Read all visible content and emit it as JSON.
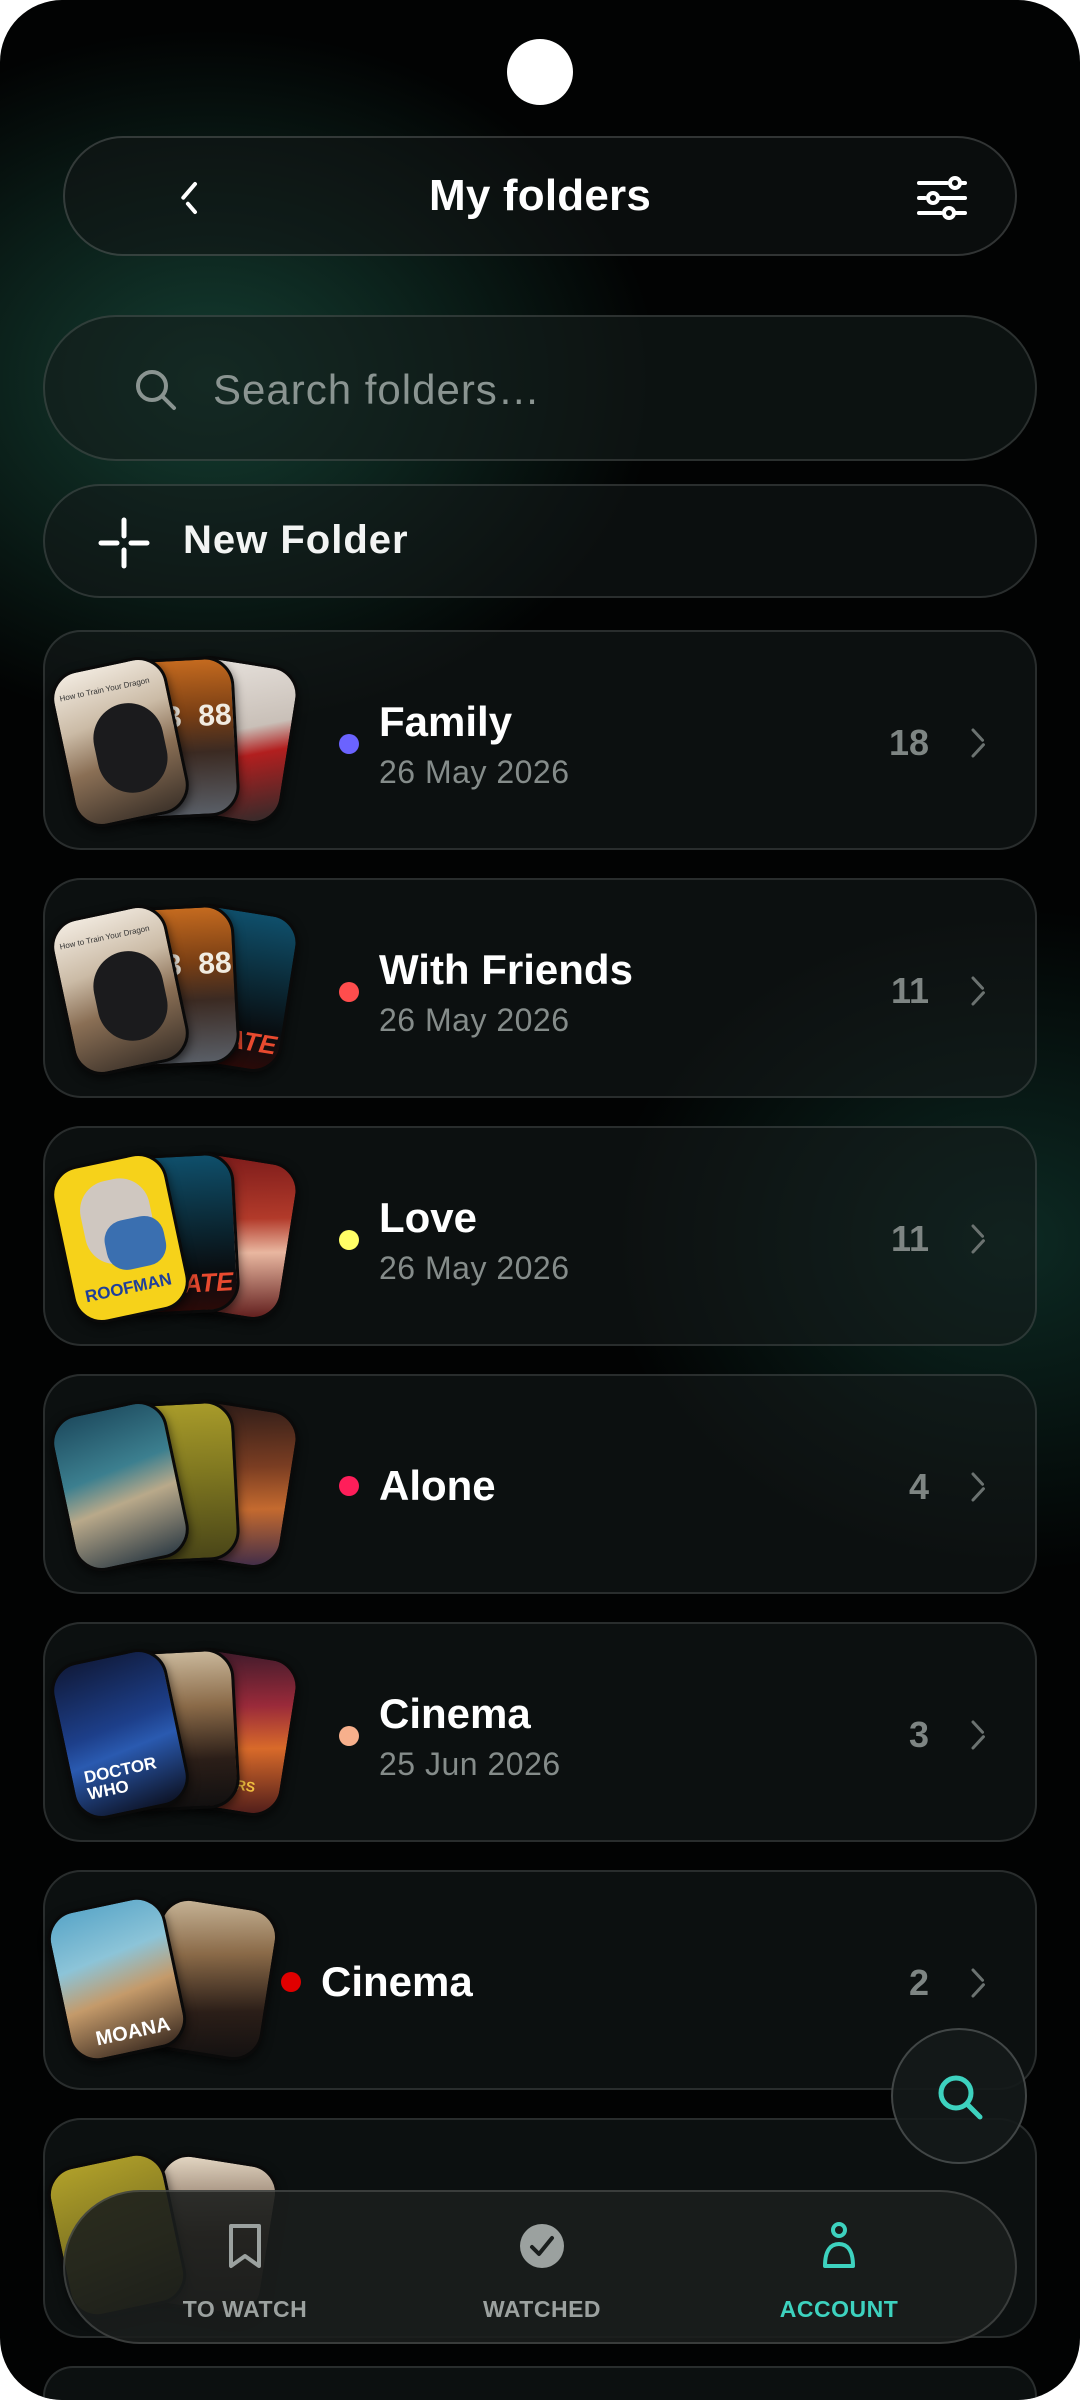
{
  "header": {
    "title": "My folders"
  },
  "search": {
    "placeholder": "Search folders…"
  },
  "new_folder": {
    "label": "New Folder"
  },
  "folders": [
    {
      "name": "Family",
      "date": "26 May 2026",
      "count": "18",
      "color": "#6b63ff"
    },
    {
      "name": "With Friends",
      "date": "26 May 2026",
      "count": "11",
      "color": "#ff4d4d"
    },
    {
      "name": "Love",
      "date": "26 May 2026",
      "count": "11",
      "color": "#ffff66"
    },
    {
      "name": "Alone",
      "date": "",
      "count": "4",
      "color": "#ff1e5a"
    },
    {
      "name": "Cinema",
      "date": "25 Jun 2026",
      "count": "3",
      "color": "#f7b08c"
    },
    {
      "name": "Cinema",
      "date": "",
      "count": "2",
      "color": "#e00000"
    }
  ],
  "poster_texts": {
    "how_to_train": "How to Train Your Dragon",
    "b88": "3  88",
    "hate": "HATE",
    "roofman": "ROOFMAN",
    "doctor_who": "DOCTOR WHO",
    "avengers": "AVENGERS",
    "moana": "MOANA"
  },
  "bottom_nav": {
    "items": [
      {
        "label": "TO WATCH",
        "icon": "bookmark-icon"
      },
      {
        "label": "WATCHED",
        "icon": "check-circle-icon"
      },
      {
        "label": "ACCOUNT",
        "icon": "person-icon",
        "active": true
      }
    ]
  },
  "accent_color": "#3dd2bf"
}
